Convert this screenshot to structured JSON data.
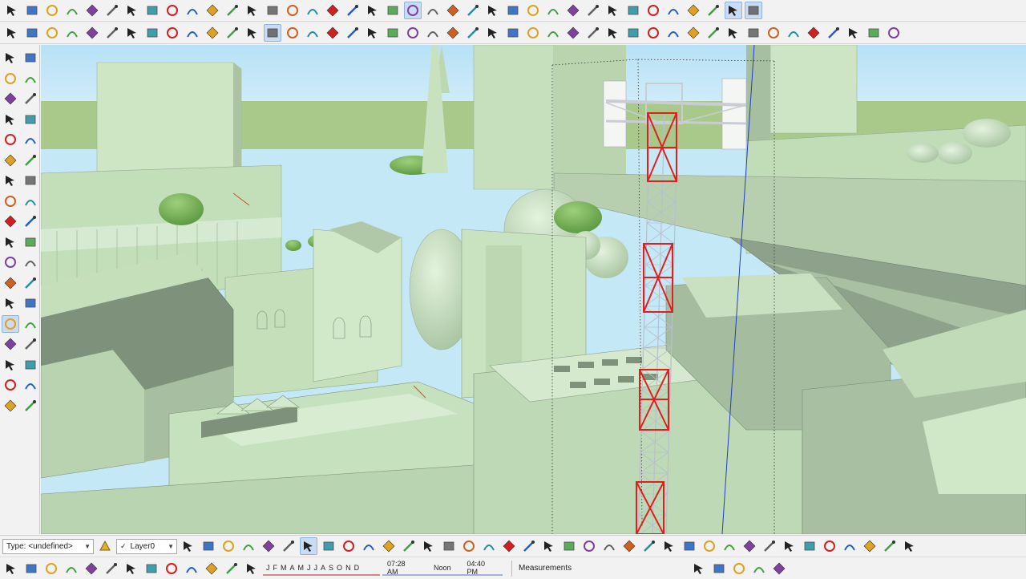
{
  "window": {
    "app": "SketchUp"
  },
  "status_bar": {
    "type_label": "Type: <undefined>",
    "layer_label": "Layer0",
    "months": [
      "J",
      "F",
      "M",
      "A",
      "M",
      "J",
      "J",
      "A",
      "S",
      "O",
      "N",
      "D"
    ],
    "time_start": "07:28 AM",
    "time_noon": "Noon",
    "time_end": "04:40 PM",
    "measurements_label": "Measurements"
  },
  "colors": {
    "building": "#c7e3bf",
    "building_shade": "#9fb59a",
    "building_dark": "#7d8f79",
    "sky": "#c6e8f7",
    "ground": "#a9c98a",
    "tower_red": "#e02020",
    "axis_blue": "#2040c0",
    "toolbar_bg": "#f2f2f2"
  },
  "icons_row1": [
    "select-icon",
    "component-icon",
    "paint-bucket-icon",
    "eraser-icon",
    "pencil-icon",
    "freehand-icon",
    "rectangle-icon",
    "rotated-rectangle-icon",
    "circle-icon",
    "polygon-icon",
    "arc-icon",
    "two-point-arc-icon",
    "three-point-arc-icon",
    "pie-icon",
    "move-icon",
    "push-pull-icon",
    "rotate-icon",
    "follow-me-icon",
    "scale-icon",
    "offset-icon",
    "orbit-icon",
    "pan-icon",
    "zoom-icon",
    "zoom-window-icon",
    "zoom-extents-icon",
    "position-camera-icon",
    "look-around-icon",
    "walk-icon",
    "tape-measure-icon",
    "dimensions-icon",
    "protractor-icon",
    "text-icon",
    "axes-icon",
    "3d-text-icon",
    "section-plane-icon",
    "sandbox-icon",
    "cube-icon",
    "cube-blue-icon"
  ],
  "icons_row2": [
    "select-icon",
    "eraser-icon",
    "pencil-icon",
    "arc-icon",
    "shapes-icon",
    "push-pull-icon",
    "follow-me-icon",
    "move-icon",
    "rotate-icon",
    "scale-icon",
    "tape-icon",
    "text-icon",
    "paint-icon",
    "orbit-icon",
    "pan-icon",
    "zoom-icon",
    "zoom-extents-icon",
    "warehouse-icon",
    "extension-icon",
    "share-icon",
    "ruby-icon",
    "user-icon",
    "line-icon",
    "curve-icon",
    "edge-icon",
    "cut-icon",
    "blob-icon",
    "loop-icon",
    "knife-icon",
    "ribbon-icon",
    "pumpkin-icon",
    "tool-icon",
    "corner-icon",
    "fillet-icon",
    "chamfer-icon",
    "box-icon",
    "pillow-icon",
    "grid-icon",
    "cylinder-icon",
    "dome-icon",
    "flag-icon",
    "sweep-icon",
    "twist-icon",
    "extrude-icon",
    "spline-icon"
  ],
  "icons_left": [
    "select-icon",
    "component-icon",
    "paint-bucket-icon",
    "eraser-icon",
    "pencil-icon",
    "freehand-icon",
    "rectangle-icon",
    "rotated-rectangle-icon",
    "circle-icon",
    "polygon-icon",
    "arc-icon",
    "two-point-arc-icon",
    "three-point-arc-icon",
    "pie-icon",
    "move-icon",
    "push-pull-icon",
    "rotate-icon",
    "follow-me-icon",
    "scale-icon",
    "offset-icon",
    "tape-measure-icon",
    "dimensions-icon",
    "protractor-icon",
    "text-icon",
    "axes-icon",
    "3d-text-icon",
    "orbit-icon",
    "pan-icon",
    "zoom-icon",
    "zoom-window-icon",
    "zoom-extents-icon",
    "previous-view-icon",
    "position-camera-icon",
    "look-around-icon",
    "walk-icon",
    "section-plane-icon"
  ],
  "icons_bottom1": [
    "style-icon",
    "xray-icon",
    "wireframe-icon",
    "hidden-line-icon",
    "shaded-icon",
    "shaded-texture-icon",
    "monochrome-icon",
    "section-icon",
    "camera-icon",
    "film-icon",
    "scene-icon",
    "scene2-icon",
    "scene3-icon",
    "ruler-icon",
    "delete-icon",
    "copy-icon",
    "layer-icon",
    "group-icon",
    "component-icon",
    "pages-icon",
    "house-icon",
    "home-icon",
    "building-icon",
    "tent-icon",
    "export-icon",
    "upload-icon",
    "cloud-icon",
    "link-icon",
    "paint-icon",
    "brick-icon",
    "roof-icon",
    "terrain-icon",
    "stamp-icon",
    "drape-icon",
    "flip-icon",
    "smooth-icon",
    "add-detail-icon"
  ],
  "icons_bottom2": [
    "add-location-icon",
    "open-folder-icon",
    "save-icon",
    "scissors-icon",
    "copy-icon",
    "paste-icon",
    "erase-icon",
    "undo-icon",
    "redo-icon",
    "print-icon",
    "model-info-icon",
    "shadow-icon",
    "view-icon",
    "share-icon",
    "download-icon",
    "extension-warehouse-icon",
    "ruby-console-icon",
    "extension-manager-icon"
  ]
}
